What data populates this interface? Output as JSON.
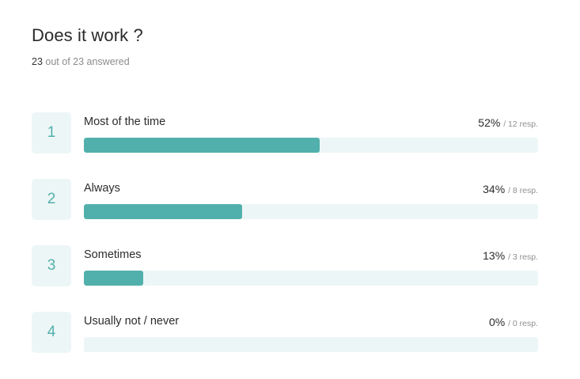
{
  "question": {
    "title": "Does it work ?",
    "answered_count": "23",
    "answered_rest": "out of 23 answered"
  },
  "answers": [
    {
      "index": "1",
      "label": "Most of the time",
      "percent_label": "52%",
      "responses_label": "/ 12 resp.",
      "fraction": 0.52
    },
    {
      "index": "2",
      "label": "Always",
      "percent_label": "34%",
      "responses_label": "/ 8 resp.",
      "fraction": 0.348
    },
    {
      "index": "3",
      "label": "Sometimes",
      "percent_label": "13%",
      "responses_label": "/ 3 resp.",
      "fraction": 0.13
    },
    {
      "index": "4",
      "label": "Usually not / never",
      "percent_label": "0%",
      "responses_label": "/ 0 resp.",
      "fraction": 0
    }
  ],
  "colors": {
    "accent": "#52b0ac",
    "track": "#edf6f6"
  }
}
